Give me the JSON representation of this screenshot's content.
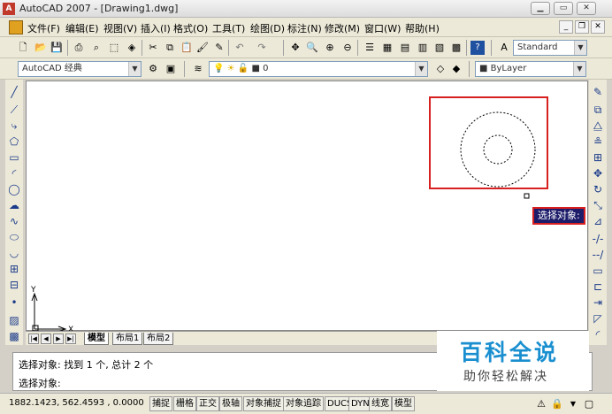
{
  "window": {
    "title": "AutoCAD 2007 - [Drawing1.dwg]"
  },
  "menu": {
    "items": [
      "文件(F)",
      "编辑(E)",
      "视图(V)",
      "插入(I)",
      "格式(O)",
      "工具(T)",
      "绘图(D)",
      "标注(N)",
      "修改(M)",
      "窗口(W)",
      "帮助(H)"
    ]
  },
  "toolbar": {
    "text_style": "Standard",
    "workspace": "AutoCAD 经典",
    "layer": "0",
    "color": "ByLayer"
  },
  "layout_tabs": {
    "items": [
      "模型",
      "布局1",
      "布局2"
    ]
  },
  "ucs": {
    "x_label": "X",
    "y_label": "Y"
  },
  "tooltip": {
    "text": "选择对象:"
  },
  "command": {
    "lines": [
      "选择对象: 找到 1 个, 总计 2 个",
      "选择对象:"
    ]
  },
  "status": {
    "coords": "1882.1423, 562.4593 , 0.0000",
    "buttons": [
      "捕捉",
      "栅格",
      "正交",
      "极轴",
      "对象捕捉",
      "对象追踪",
      "DUCS",
      "DYN",
      "线宽",
      "模型"
    ]
  },
  "watermark": {
    "title": "百科全说",
    "subtitle": "助你轻松解决"
  },
  "colors": {
    "highlight_border": "#d82020",
    "tooltip_bg": "#1c1c6a",
    "watermark_blue": "#1a8fd0"
  }
}
